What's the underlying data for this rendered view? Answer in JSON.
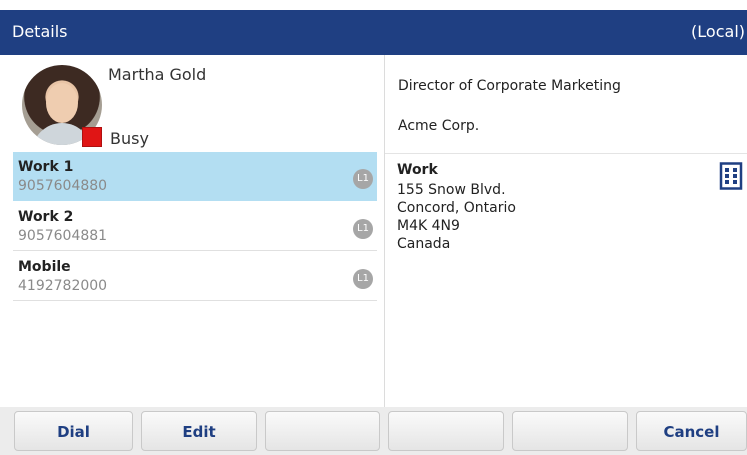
{
  "header": {
    "title": "Details",
    "mode": "(Local)"
  },
  "contact": {
    "name": "Martha Gold",
    "status": "Busy",
    "status_color": "#e01515"
  },
  "numbers": [
    {
      "label": "Work 1",
      "number": "9057604880",
      "line": "L1",
      "selected": true
    },
    {
      "label": "Work 2",
      "number": "9057604881",
      "line": "L1",
      "selected": false
    },
    {
      "label": "Mobile",
      "number": "4192782000",
      "line": "L1",
      "selected": false
    }
  ],
  "details": {
    "job_title": "Director of Corporate Marketing",
    "company": "Acme Corp.",
    "address": {
      "label": "Work",
      "lines": [
        "155 Snow Blvd.",
        "Concord, Ontario",
        "M4K 4N9",
        "Canada"
      ],
      "icon": "building-icon"
    }
  },
  "softkeys": [
    "Dial",
    "Edit",
    "",
    "",
    "",
    "Cancel"
  ],
  "colors": {
    "header_bg": "#1f3f82",
    "selected_row": "#b3def2",
    "softkey_text": "#1f3f82"
  }
}
